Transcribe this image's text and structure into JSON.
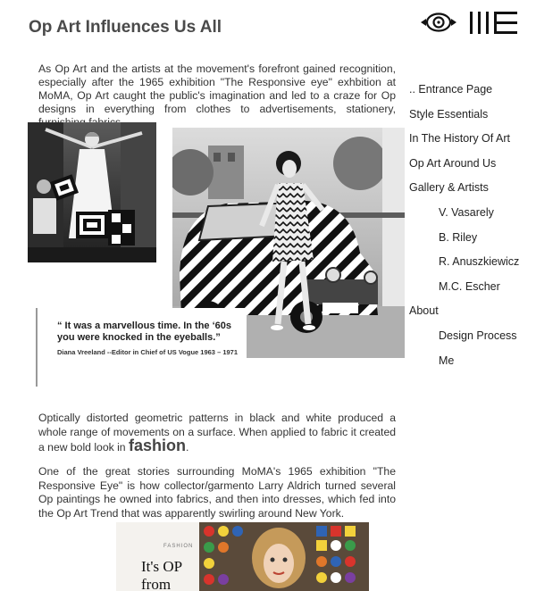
{
  "page": {
    "title": "Op Art Influences Us All",
    "intro": "As Op Art and the artists at the movement's forefront gained recognition, especially after the 1965 exhibition \"The Responsive eye\" exhbition at MoMA, Op Art caught the public's imagination and led to a craze for Op designs in everything from clothes to advertisements, stationery, furnishing fabrics."
  },
  "logo": {
    "icons": [
      "eye-icon",
      "bars-logo-icon"
    ]
  },
  "menu": {
    "items": [
      {
        "label": ".. Entrance Page",
        "level": 0
      },
      {
        "label": "Style Essentials",
        "level": 0
      },
      {
        "label": "In The History Of Art",
        "level": 0
      },
      {
        "label": "Op Art Around Us",
        "level": 0
      },
      {
        "label": "Gallery & Artists",
        "level": 0
      },
      {
        "label": "V. Vasarely",
        "level": 1
      },
      {
        "label": "B. Riley",
        "level": 1
      },
      {
        "label": "R. Anuszkiewicz",
        "level": 1
      },
      {
        "label": "M.C. Escher",
        "level": 1
      },
      {
        "label": "About",
        "level": 0
      },
      {
        "label": "Design Process",
        "level": 1
      },
      {
        "label": "Me",
        "level": 1
      }
    ]
  },
  "quote": {
    "text": "“ It was a marvellous time. In the ‘60s you were knocked in the eyeballs.”",
    "cite": "Diana Vreeland  --Editor in Chief of US Vogue 1963 – 1971"
  },
  "para2": {
    "text": "Optically distorted geometric patterns in black and white produced a whole range of movements on a surface. When applied to fabric it created a new bold look in ",
    "big": "fashion",
    "end": "."
  },
  "para3": "One of the great stories surrounding MoMA's 1965 exhibition \"The Responsive Eye\" is how collector/garmento Larry Aldrich turned several Op paintings he owned into fabrics, and then into dresses, which fed into the Op Art Trend that was apparently swirling around New York.",
  "magazine": {
    "kicker": "FASHION",
    "headline": "It's OP from"
  },
  "colors": {
    "text": "#333333",
    "title": "#4a4a4a",
    "background": "#ffffff"
  }
}
